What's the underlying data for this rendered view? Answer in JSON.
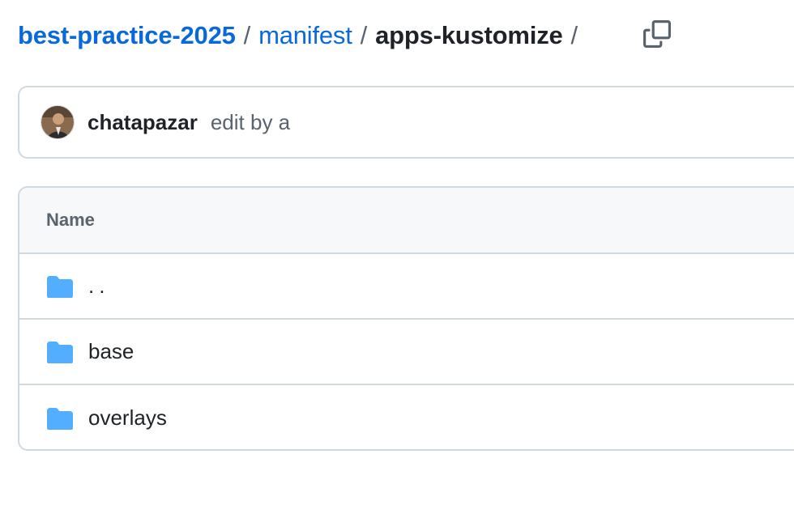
{
  "breadcrumb": {
    "repo": "best-practice-2025",
    "folder": "manifest",
    "current": "apps-kustomize",
    "separator": "/"
  },
  "copy_button": {
    "icon": "copy-icon"
  },
  "commit": {
    "author": "chatapazar",
    "message": "edit by a"
  },
  "table": {
    "header_name": "Name",
    "rows": [
      {
        "name": "..",
        "type": "folder"
      },
      {
        "name": "base",
        "type": "folder"
      },
      {
        "name": "overlays",
        "type": "folder"
      }
    ]
  },
  "colors": {
    "link": "#0969da",
    "folder": "#54aeff",
    "border": "#d1d9e0",
    "header_bg": "#f6f8fa"
  }
}
